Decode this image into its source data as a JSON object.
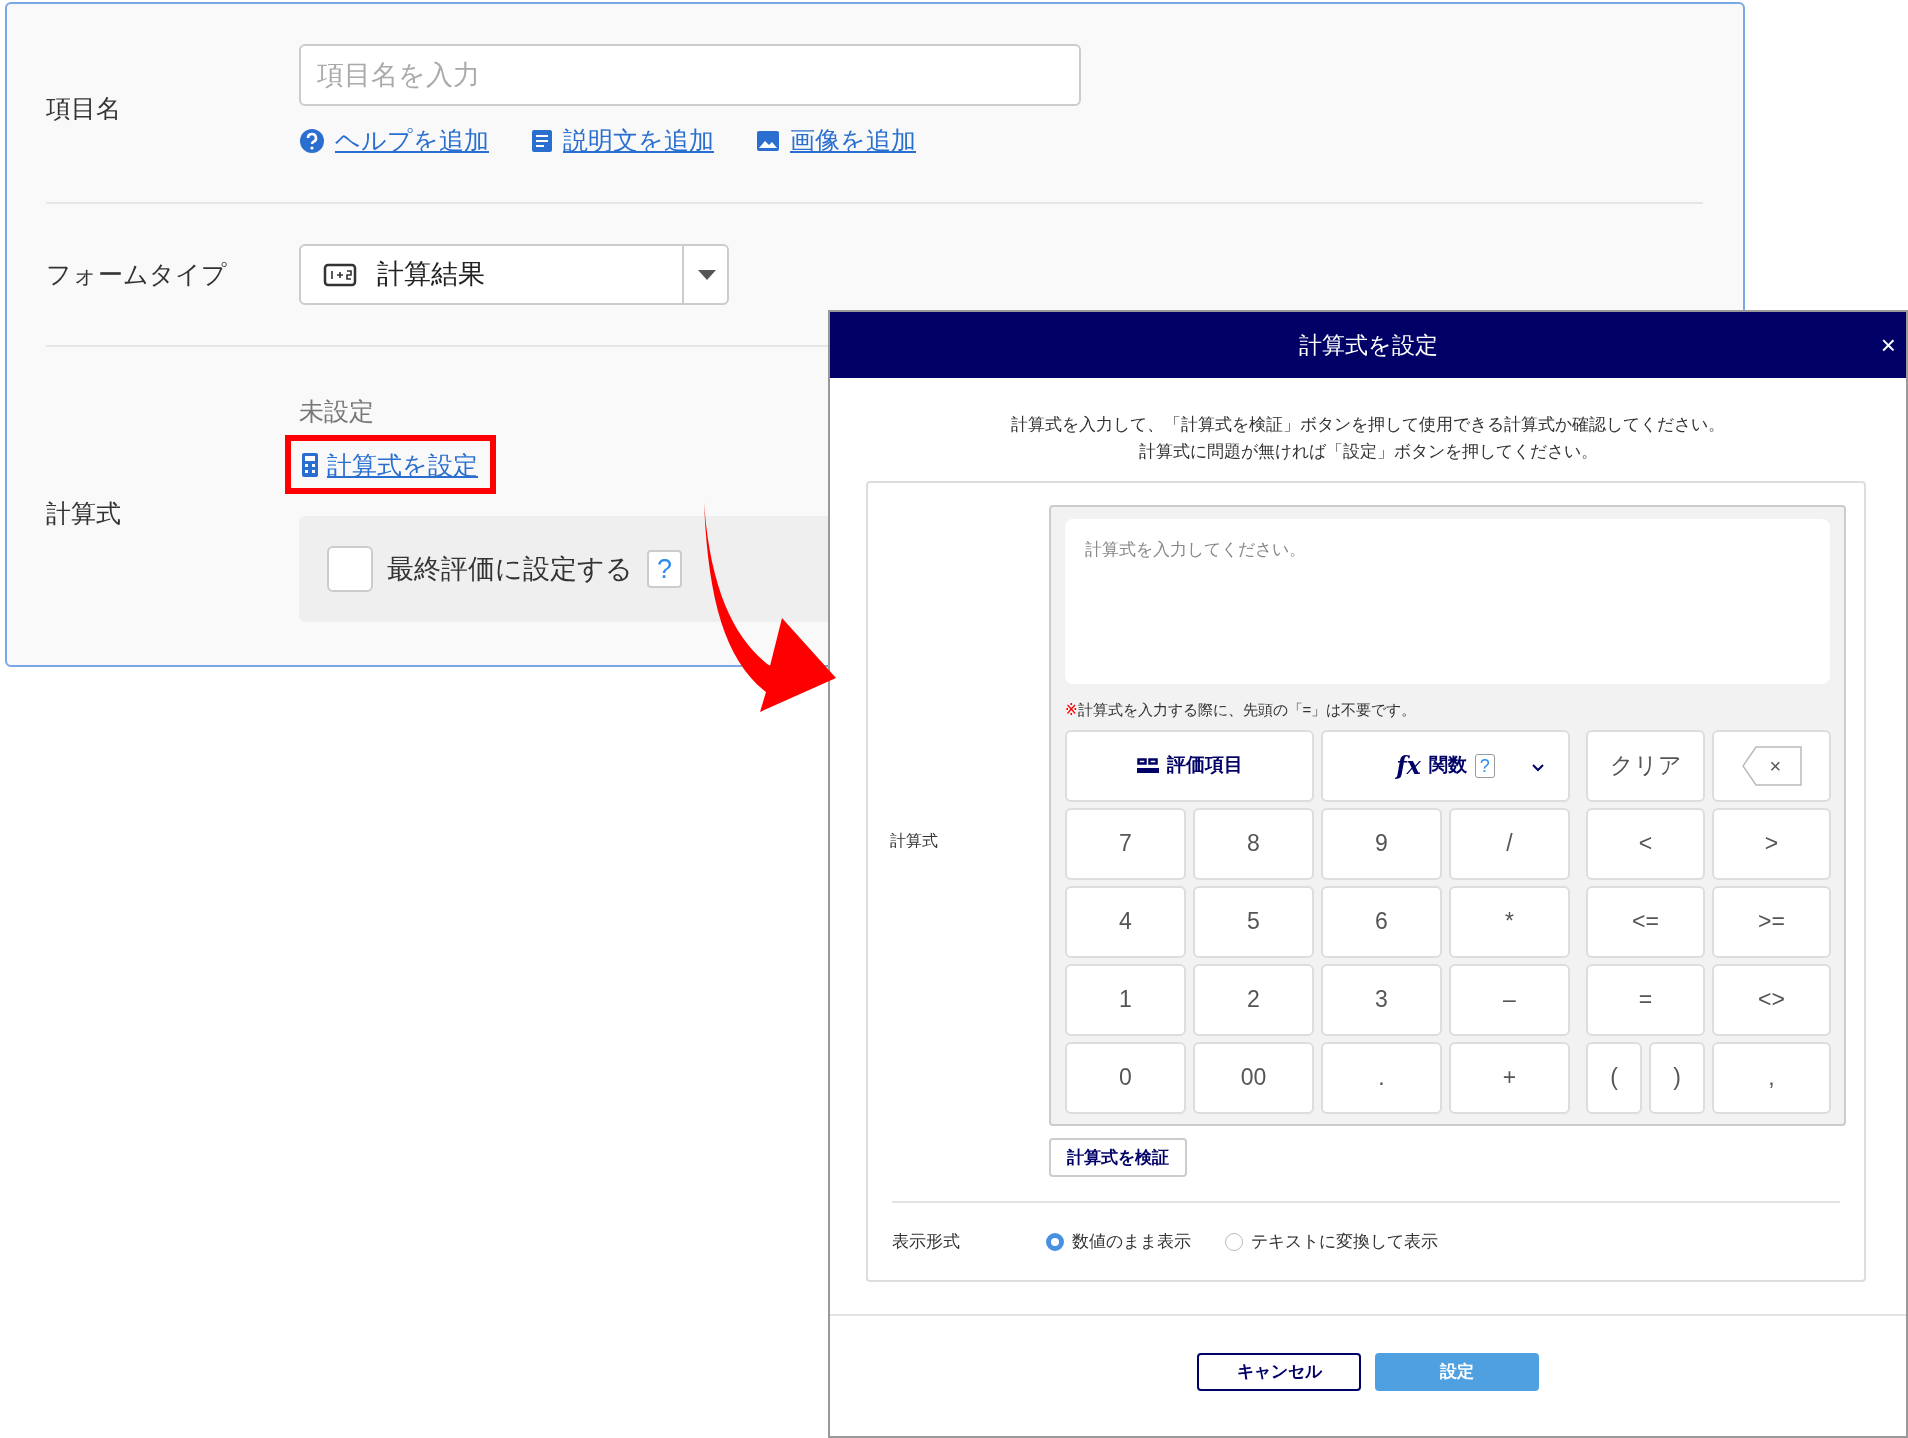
{
  "form": {
    "item_name": {
      "label": "項目名",
      "placeholder": "項目名を入力",
      "links": [
        {
          "kind": "help",
          "label": "ヘルプを追加"
        },
        {
          "kind": "description",
          "label": "説明文を追加"
        },
        {
          "kind": "image",
          "label": "画像を追加"
        }
      ]
    },
    "form_type": {
      "label": "フォームタイプ",
      "value": "計算結果"
    },
    "formula": {
      "label": "計算式",
      "status": "未設定",
      "link": "計算式を設定",
      "highlighted": true,
      "final_checkbox": {
        "label": "最終評価に設定する",
        "checked": false,
        "help": "?"
      }
    }
  },
  "dialog": {
    "title": "計算式を設定",
    "close": "×",
    "instructions": [
      "計算式を入力して、「計算式を検証」ボタンを押して使用できる計算式か確認してください。",
      "計算式に問題が無ければ「設定」ボタンを押してください。"
    ],
    "formula_label": "計算式",
    "placeholder": "計算式を入力してください。",
    "note_mark": "※",
    "note": "計算式を入力する際に、先頭の「=」は不要です。",
    "items_button": "評価項目",
    "functions_button": {
      "icon": "fx",
      "label": "関数",
      "help": "?"
    },
    "clear_button": "クリア",
    "backspace": "×",
    "left_keys": [
      "7",
      "8",
      "9",
      "/",
      "4",
      "5",
      "6",
      "*",
      "1",
      "2",
      "3",
      "–",
      "0",
      "00",
      ".",
      "+"
    ],
    "right_keys": [
      [
        "<",
        ">"
      ],
      [
        "<=",
        ">="
      ],
      [
        "=",
        "<>"
      ],
      [
        "(",
        ")",
        ","
      ]
    ],
    "verify_button": "計算式を検証",
    "display_format": {
      "label": "表示形式",
      "options": [
        {
          "label": "数値のまま表示",
          "selected": true
        },
        {
          "label": "テキストに変換して表示",
          "selected": false
        }
      ]
    },
    "buttons": [
      {
        "kind": "secondary",
        "label": "キャンセル"
      },
      {
        "kind": "primary",
        "label": "設定"
      }
    ]
  }
}
